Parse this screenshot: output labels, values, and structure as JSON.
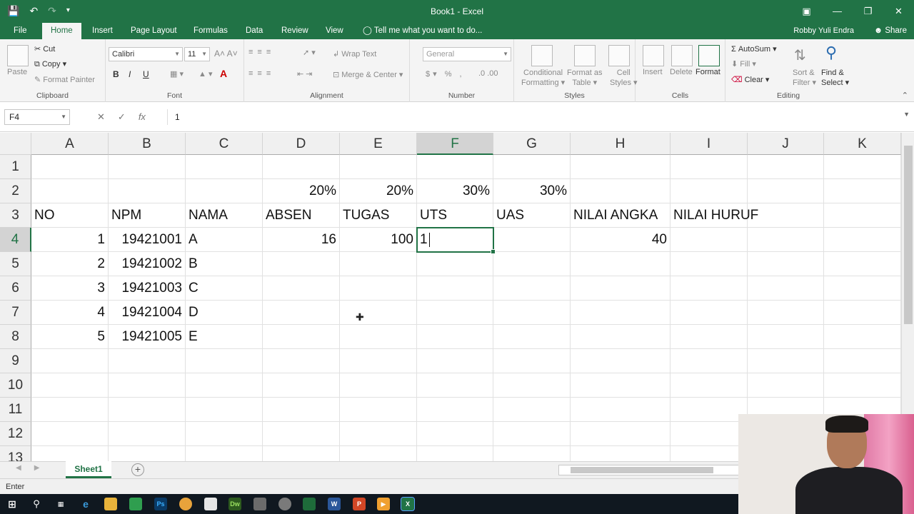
{
  "window": {
    "title": "Book1 - Excel"
  },
  "menu": {
    "tabs": [
      "File",
      "Home",
      "Insert",
      "Page Layout",
      "Formulas",
      "Data",
      "Review",
      "View"
    ],
    "tell_me": "Tell me what you want to do...",
    "user": "Robby Yuli Endra",
    "share": "Share"
  },
  "ribbon": {
    "clipboard": {
      "paste": "Paste",
      "cut": "Cut",
      "copy": "Copy",
      "format_painter": "Format Painter",
      "label": "Clipboard"
    },
    "font": {
      "name": "Calibri",
      "size": "11",
      "bold": "B",
      "italic": "I",
      "underline": "U",
      "label": "Font"
    },
    "alignment": {
      "wrap_text": "Wrap Text",
      "merge_center": "Merge & Center",
      "label": "Alignment"
    },
    "number": {
      "format": "General",
      "label": "Number"
    },
    "styles": {
      "conditional": "Conditional",
      "formatting": "Formatting",
      "format_as": "Format as",
      "table": "Table",
      "cell": "Cell",
      "cell_styles": "Styles",
      "label": "Styles"
    },
    "cells": {
      "insert": "Insert",
      "delete": "Delete",
      "format": "Format",
      "label": "Cells"
    },
    "editing": {
      "autosum": "AutoSum",
      "fill": "Fill",
      "clear": "Clear",
      "sort": "Sort &",
      "filter": "Filter",
      "find": "Find &",
      "select": "Select",
      "label": "Editing"
    }
  },
  "formula_bar": {
    "name_box": "F4",
    "value": "1"
  },
  "grid": {
    "columns": [
      "A",
      "B",
      "C",
      "D",
      "E",
      "F",
      "G",
      "H",
      "I",
      "J",
      "K"
    ],
    "rows": [
      "1",
      "2",
      "3",
      "4",
      "5",
      "6",
      "7",
      "8",
      "9",
      "10",
      "11",
      "12",
      "13"
    ],
    "cells": {
      "D2": "20%",
      "E2": "20%",
      "F2": "30%",
      "G2": "30%",
      "A3": "NO",
      "B3": "NPM",
      "C3": "NAMA",
      "D3": "ABSEN",
      "E3": "TUGAS",
      "F3": "UTS",
      "G3": "UAS",
      "H3": "NILAI ANGKA",
      "I3": "NILAI HURUF",
      "A4": "1",
      "B4": "19421001",
      "C4": "A",
      "D4": "16",
      "E4": "100",
      "F4": "1",
      "H4": "40",
      "A5": "2",
      "B5": "19421002",
      "C5": "B",
      "A6": "3",
      "B6": "19421003",
      "C6": "C",
      "A7": "4",
      "B7": "19421004",
      "C7": "D",
      "A8": "5",
      "B8": "19421005",
      "C8": "E"
    },
    "active_cell": "F4"
  },
  "sheets": [
    "Sheet1"
  ],
  "status": {
    "mode": "Enter"
  },
  "colors": {
    "excel_green": "#217346"
  }
}
